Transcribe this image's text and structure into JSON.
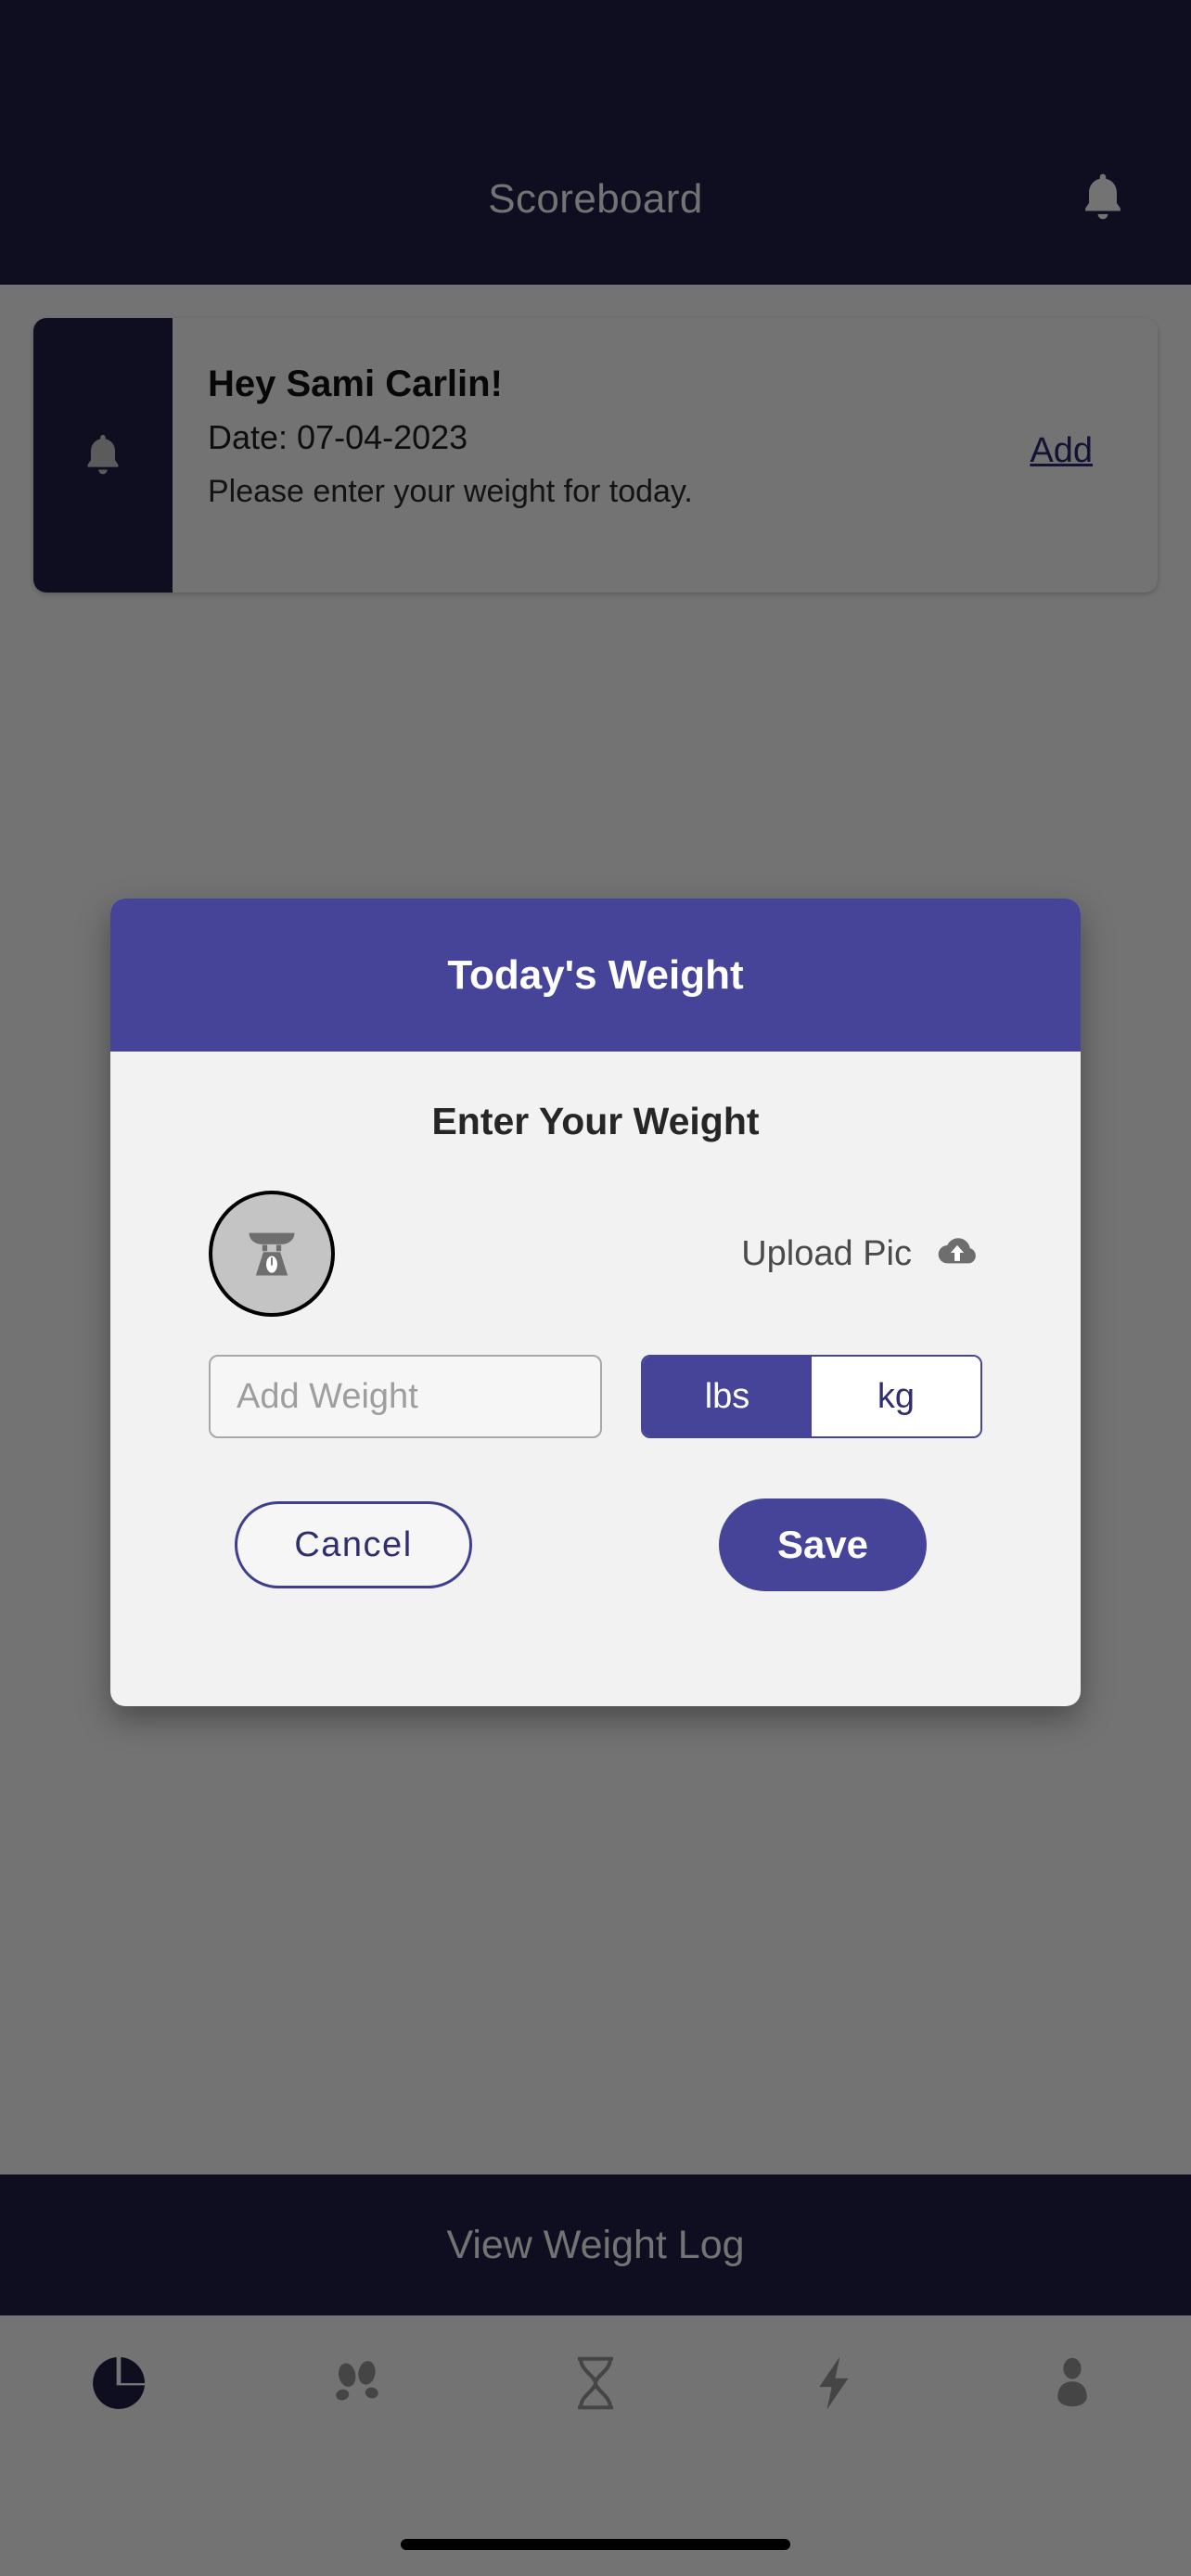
{
  "header": {
    "title": "Scoreboard",
    "bell_icon": "bell-icon"
  },
  "notification": {
    "icon": "bell-icon",
    "greeting": "Hey Sami Carlin!",
    "date": "Date: 07-04-2023",
    "message": "Please enter your weight for today.",
    "action_label": "Add",
    "action_color": "#2a2a72"
  },
  "modal": {
    "title": "Today's Weight",
    "subtitle": "Enter Your Weight",
    "header_color": "#454498",
    "body_color": "#f2f2f2",
    "scale_icon": "weight-scale-icon",
    "upload": {
      "label": "Upload Pic",
      "icon": "cloud-upload-icon"
    },
    "weight_input": {
      "placeholder": "Add Weight",
      "value": ""
    },
    "units": [
      {
        "label": "lbs",
        "selected": true
      },
      {
        "label": "kg",
        "selected": false
      }
    ],
    "cancel_label": "Cancel",
    "save_label": "Save"
  },
  "view_log": {
    "label": "View Weight Log",
    "background": "#211f47"
  },
  "bottom_nav": {
    "items": [
      {
        "icon": "pie-chart-icon",
        "active": true
      },
      {
        "icon": "footprints-icon",
        "active": false
      },
      {
        "icon": "hourglass-icon",
        "active": false
      },
      {
        "icon": "lightning-bolt-icon",
        "active": false
      },
      {
        "icon": "person-icon",
        "active": false
      }
    ],
    "active_color": "#211f47",
    "inactive_color": "#9a9a9a"
  }
}
